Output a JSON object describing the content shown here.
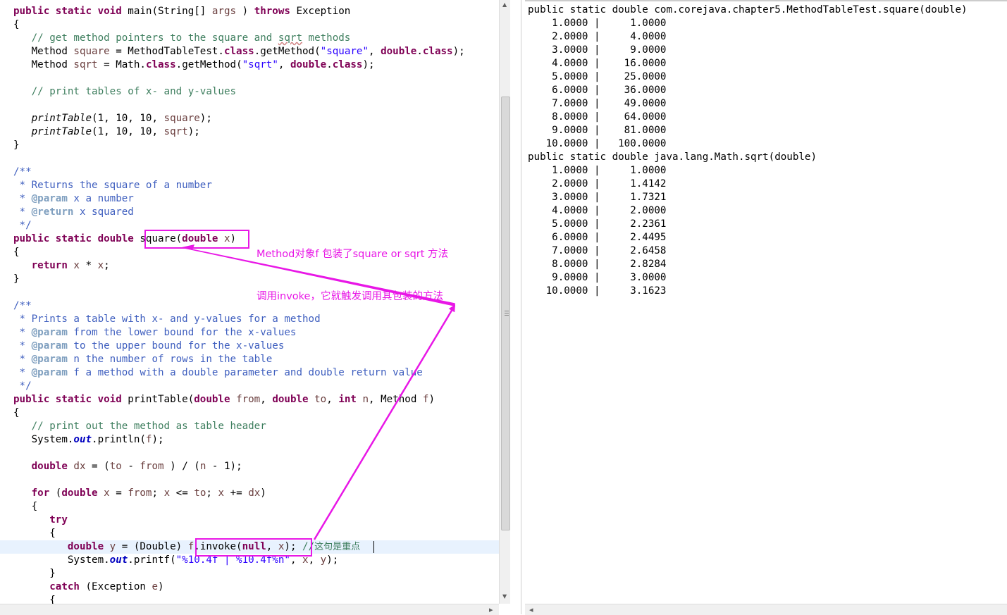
{
  "editor": {
    "lines": [
      [
        [
          "k",
          "public static void "
        ],
        [
          "",
          "main(String[] "
        ],
        [
          "v",
          "args"
        ],
        [
          "",
          " ) "
        ],
        [
          "k",
          "throws"
        ],
        [
          "",
          " Exception"
        ]
      ],
      [
        [
          "",
          "{"
        ]
      ],
      [
        [
          "c",
          "   // get method pointers to the square and "
        ],
        [
          "c sq",
          "sqrt"
        ],
        [
          "c",
          " methods"
        ]
      ],
      [
        [
          "",
          "   Method "
        ],
        [
          "v",
          "square"
        ],
        [
          "",
          " = MethodTableTest."
        ],
        [
          "k",
          "class"
        ],
        [
          "",
          ".getMethod("
        ],
        [
          "s",
          "\"square\""
        ],
        [
          "",
          ", "
        ],
        [
          "k",
          "double"
        ],
        [
          "",
          "."
        ],
        [
          "k",
          "class"
        ],
        [
          "",
          ");"
        ]
      ],
      [
        [
          "",
          "   Method "
        ],
        [
          "v",
          "sqrt"
        ],
        [
          "",
          " = Math."
        ],
        [
          "k",
          "class"
        ],
        [
          "",
          ".getMethod("
        ],
        [
          "s",
          "\"sqrt\""
        ],
        [
          "",
          ", "
        ],
        [
          "k",
          "double"
        ],
        [
          "",
          "."
        ],
        [
          "k",
          "class"
        ],
        [
          "",
          ");"
        ]
      ],
      [
        [
          "",
          ""
        ]
      ],
      [
        [
          "c",
          "   // print tables of x- and y-values"
        ]
      ],
      [
        [
          "",
          ""
        ]
      ],
      [
        [
          "it",
          "   printTable"
        ],
        [
          "",
          "(1, 10, 10, "
        ],
        [
          "v",
          "square"
        ],
        [
          "",
          ");"
        ]
      ],
      [
        [
          "it",
          "   printTable"
        ],
        [
          "",
          "(1, 10, 10, "
        ],
        [
          "v",
          "sqrt"
        ],
        [
          "",
          ");"
        ]
      ],
      [
        [
          "",
          "}"
        ]
      ],
      [
        [
          "",
          ""
        ]
      ],
      [
        [
          "jd",
          "/**"
        ]
      ],
      [
        [
          "jd",
          " * Returns the square of a number"
        ]
      ],
      [
        [
          "jd",
          " * "
        ],
        [
          "tag",
          "@param"
        ],
        [
          "jd",
          " x a number"
        ]
      ],
      [
        [
          "jd",
          " * "
        ],
        [
          "tag",
          "@return"
        ],
        [
          "jd",
          " x squared"
        ]
      ],
      [
        [
          "jd",
          " */"
        ]
      ],
      [
        [
          "k",
          "public static double "
        ],
        [
          "",
          "square("
        ],
        [
          "k",
          "double"
        ],
        [
          "v",
          " x"
        ],
        [
          "",
          ")"
        ]
      ],
      [
        [
          "",
          "{"
        ]
      ],
      [
        [
          "k",
          "   return"
        ],
        [
          "v",
          " x"
        ],
        [
          "",
          " * "
        ],
        [
          "v",
          "x"
        ],
        [
          "",
          ";"
        ]
      ],
      [
        [
          "",
          "}"
        ]
      ],
      [
        [
          "",
          ""
        ]
      ],
      [
        [
          "jd",
          "/**"
        ]
      ],
      [
        [
          "jd",
          " * Prints a table with x- and y-values for a method"
        ]
      ],
      [
        [
          "jd",
          " * "
        ],
        [
          "tag",
          "@param"
        ],
        [
          "jd",
          " from the lower bound for the x-values"
        ]
      ],
      [
        [
          "jd",
          " * "
        ],
        [
          "tag",
          "@param"
        ],
        [
          "jd",
          " to the upper bound for the x-values"
        ]
      ],
      [
        [
          "jd",
          " * "
        ],
        [
          "tag",
          "@param"
        ],
        [
          "jd",
          " n the number of rows in the table"
        ]
      ],
      [
        [
          "jd",
          " * "
        ],
        [
          "tag",
          "@param"
        ],
        [
          "jd",
          " f a method with a double parameter and double return value"
        ]
      ],
      [
        [
          "jd",
          " */"
        ]
      ],
      [
        [
          "k",
          "public static void "
        ],
        [
          "",
          "printTable("
        ],
        [
          "k",
          "double "
        ],
        [
          "v",
          "from"
        ],
        [
          "",
          ", "
        ],
        [
          "k",
          "double "
        ],
        [
          "v",
          "to"
        ],
        [
          "",
          ", "
        ],
        [
          "k",
          "int "
        ],
        [
          "v",
          "n"
        ],
        [
          "",
          ", Method "
        ],
        [
          "v",
          "f"
        ],
        [
          "",
          ")"
        ]
      ],
      [
        [
          "",
          "{"
        ]
      ],
      [
        [
          "c",
          "   // print out the method as table header"
        ]
      ],
      [
        [
          "",
          "   System."
        ],
        [
          "f",
          "out"
        ],
        [
          "",
          ".println("
        ],
        [
          "v",
          "f"
        ],
        [
          "",
          ");"
        ]
      ],
      [
        [
          "",
          ""
        ]
      ],
      [
        [
          "k",
          "   double "
        ],
        [
          "v",
          "dx"
        ],
        [
          "",
          " = ("
        ],
        [
          "v",
          "to"
        ],
        [
          "",
          " - "
        ],
        [
          "v",
          "from"
        ],
        [
          "",
          " ) / ("
        ],
        [
          "v",
          "n"
        ],
        [
          "",
          " - 1);"
        ]
      ],
      [
        [
          "",
          ""
        ]
      ],
      [
        [
          "k",
          "   for"
        ],
        [
          "",
          " ("
        ],
        [
          "k",
          "double "
        ],
        [
          "v",
          "x"
        ],
        [
          "",
          " = "
        ],
        [
          "v",
          "from"
        ],
        [
          "",
          "; "
        ],
        [
          "v",
          "x"
        ],
        [
          "",
          " <= "
        ],
        [
          "v",
          "to"
        ],
        [
          "",
          "; "
        ],
        [
          "v",
          "x"
        ],
        [
          "",
          " += "
        ],
        [
          "v",
          "dx"
        ],
        [
          "",
          ")"
        ]
      ],
      [
        [
          "",
          "   {"
        ]
      ],
      [
        [
          "k",
          "      try"
        ]
      ],
      [
        [
          "",
          "      {"
        ]
      ],
      [
        [
          "k",
          "         double "
        ],
        [
          "v",
          "y"
        ],
        [
          "",
          " = (Double) "
        ],
        [
          "v",
          "f"
        ],
        [
          "",
          ".invoke("
        ],
        [
          "k",
          "null"
        ],
        [
          "",
          ", "
        ],
        [
          "v",
          "x"
        ],
        [
          "",
          ");"
        ],
        [
          "c",
          " //"
        ],
        [
          "c cjk",
          "这句是重点"
        ]
      ],
      [
        [
          "",
          "         System."
        ],
        [
          "f",
          "out"
        ],
        [
          "",
          ".printf("
        ],
        [
          "s",
          "\"%10.4f | %10.4f%n\""
        ],
        [
          "",
          ", "
        ],
        [
          "v",
          "x"
        ],
        [
          "",
          ", "
        ],
        [
          "v",
          "y"
        ],
        [
          "",
          ");"
        ]
      ],
      [
        [
          "",
          "      }"
        ]
      ],
      [
        [
          "k",
          "      catch"
        ],
        [
          "",
          " (Exception "
        ],
        [
          "v",
          "e"
        ],
        [
          "",
          ")"
        ]
      ],
      [
        [
          "",
          "      {"
        ]
      ]
    ]
  },
  "console": {
    "lines": [
      "public static double com.corejava.chapter5.MethodTableTest.square(double)",
      "    1.0000 |     1.0000",
      "    2.0000 |     4.0000",
      "    3.0000 |     9.0000",
      "    4.0000 |    16.0000",
      "    5.0000 |    25.0000",
      "    6.0000 |    36.0000",
      "    7.0000 |    49.0000",
      "    8.0000 |    64.0000",
      "    9.0000 |    81.0000",
      "   10.0000 |   100.0000",
      "public static double java.lang.Math.sqrt(double)",
      "    1.0000 |     1.0000",
      "    2.0000 |     1.4142",
      "    3.0000 |     1.7321",
      "    4.0000 |     2.0000",
      "    5.0000 |     2.2361",
      "    6.0000 |     2.4495",
      "    7.0000 |     2.6458",
      "    8.0000 |     2.8284",
      "    9.0000 |     3.0000",
      "   10.0000 |     3.1623"
    ]
  },
  "annotation": {
    "line1": "Method对象f 包装了square or sqrt 方法",
    "line2": "调用invoke，它就触发调用其包装的方法",
    "color": "#e817e6"
  },
  "scrollbar": {
    "up_arrow": "▲",
    "down_arrow": "▼",
    "right_arrow": "▸",
    "left_arrow": "◂"
  }
}
